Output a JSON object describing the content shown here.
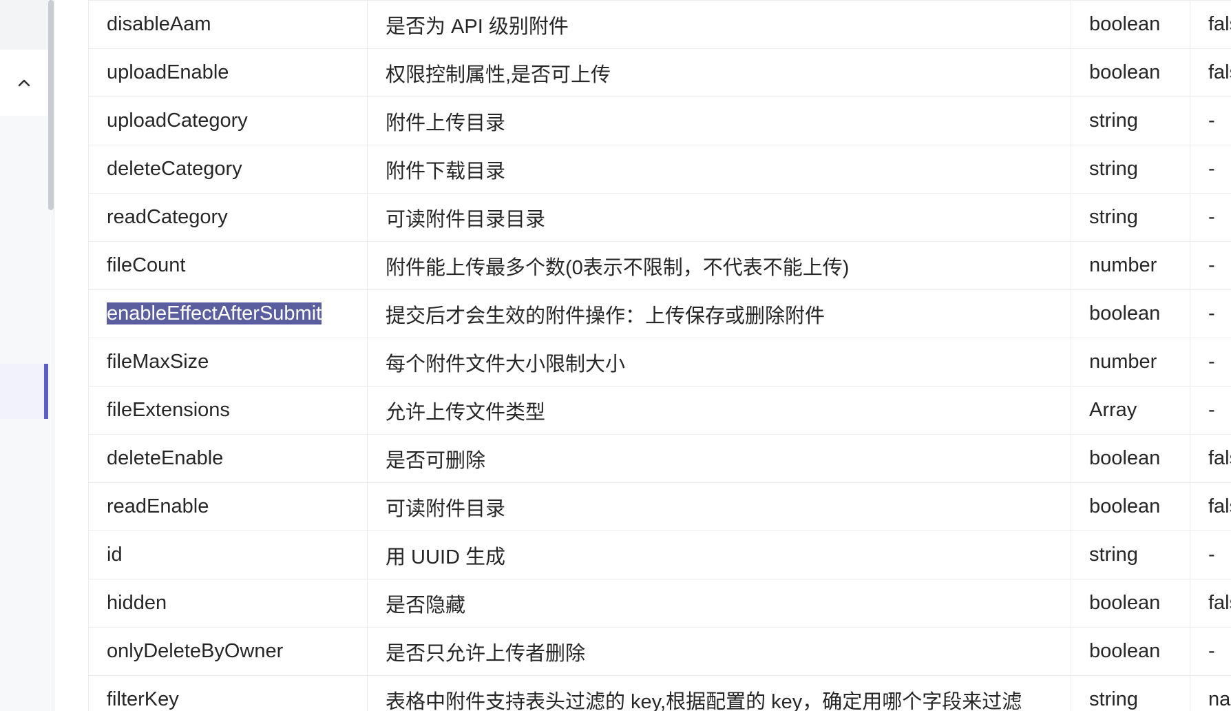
{
  "sidebar": {
    "collapse_icon": "chevron-up-icon"
  },
  "table": {
    "rows": [
      {
        "name": "disableAam",
        "description": "是否为 API 级别附件",
        "type": "boolean",
        "default": "false"
      },
      {
        "name": "uploadEnable",
        "description": "权限控制属性,是否可上传",
        "type": "boolean",
        "default": "false"
      },
      {
        "name": "uploadCategory",
        "description": "附件上传目录",
        "type": "string",
        "default": "-"
      },
      {
        "name": "deleteCategory",
        "description": "附件下载目录",
        "type": "string",
        "default": "-"
      },
      {
        "name": "readCategory",
        "description": "可读附件目录目录",
        "type": "string",
        "default": "-"
      },
      {
        "name": "fileCount",
        "description": "附件能上传最多个数(0表示不限制，不代表不能上传)",
        "type": "number",
        "default": "-"
      },
      {
        "name": "enableEffectAfterSubmit",
        "description": "提交后才会生效的附件操作：上传保存或删除附件",
        "type": "boolean",
        "default": "-",
        "selected": true
      },
      {
        "name": "fileMaxSize",
        "description": "每个附件文件大小限制大小",
        "type": "number",
        "default": "-"
      },
      {
        "name": "fileExtensions",
        "description": "允许上传文件类型",
        "type": "Array",
        "default": "-"
      },
      {
        "name": "deleteEnable",
        "description": "是否可删除",
        "type": "boolean",
        "default": "false"
      },
      {
        "name": "readEnable",
        "description": "可读附件目录",
        "type": "boolean",
        "default": "false"
      },
      {
        "name": "id",
        "description": "用 UUID 生成",
        "type": "string",
        "default": "-"
      },
      {
        "name": "hidden",
        "description": "是否隐藏",
        "type": "boolean",
        "default": "false"
      },
      {
        "name": "onlyDeleteByOwner",
        "description": "是否只允许上传者删除",
        "type": "boolean",
        "default": "-"
      },
      {
        "name": "filterKey",
        "description": "表格中附件支持表头过滤的 key,根据配置的 key，确定用哪个字段来过滤",
        "type": "string",
        "default": "name"
      }
    ]
  },
  "colors": {
    "accent": "#5b5fc7",
    "selection": "#5b5e9e",
    "border": "#ececec"
  }
}
